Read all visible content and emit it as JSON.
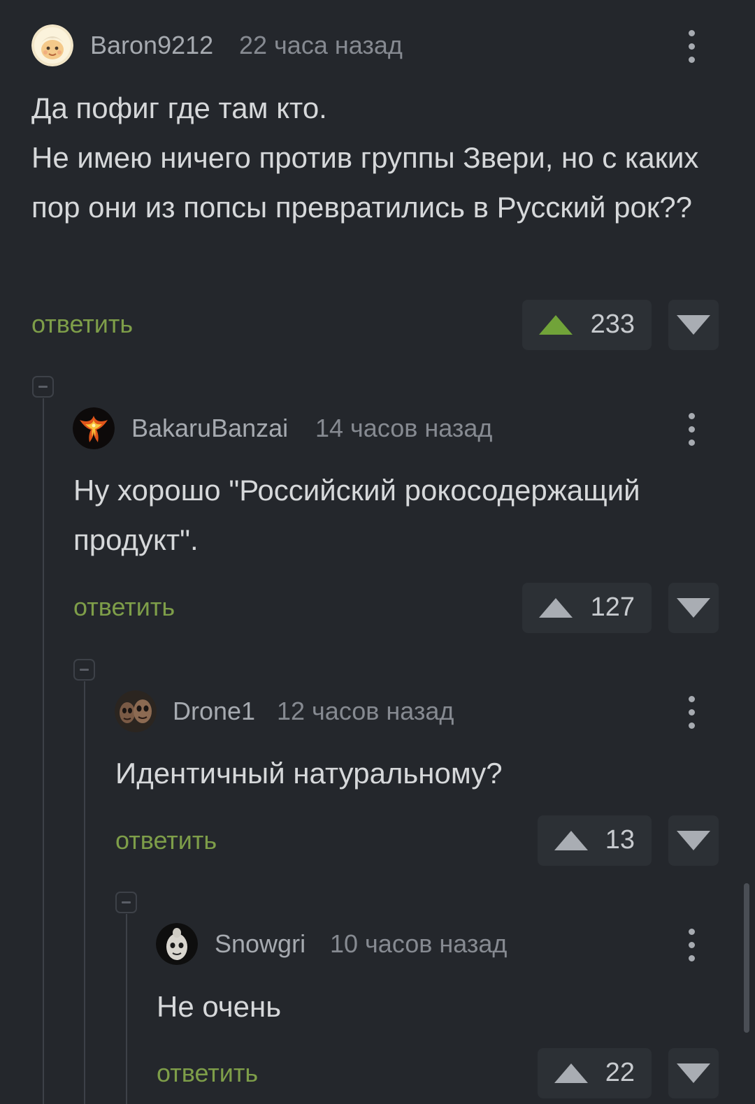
{
  "comments": [
    {
      "username": "Baron9212",
      "time": "22 часа назад",
      "text": "Да пофиг где там кто.\nНе имею ничего против группы Звери, но с каких пор они из попсы превратились в Русский рок??",
      "reply_label": "ответить",
      "votes": "233",
      "avatar_icon": "cartoon-face-avatar",
      "upvoted": true
    },
    {
      "username": "BakaruBanzai",
      "time": "14 часов назад",
      "text": "Ну хорошо \"Российский рокосодержащий продукт\".",
      "reply_label": "ответить",
      "votes": "127",
      "avatar_icon": "phoenix-avatar",
      "upvoted": false
    },
    {
      "username": "Drone1",
      "time": "12 часов назад",
      "text": "Идентичный натуральному?",
      "reply_label": "ответить",
      "votes": "13",
      "avatar_icon": "two-faces-avatar",
      "upvoted": false
    },
    {
      "username": "Snowgri",
      "time": "10 часов назад",
      "text": "Не очень",
      "reply_label": "ответить",
      "votes": "22",
      "avatar_icon": "mask-avatar",
      "upvoted": false
    }
  ],
  "colors": {
    "background": "#24272c",
    "reply_link": "#7e9e49",
    "upvote_active": "#71a339",
    "vote_box": "#2c3035"
  }
}
